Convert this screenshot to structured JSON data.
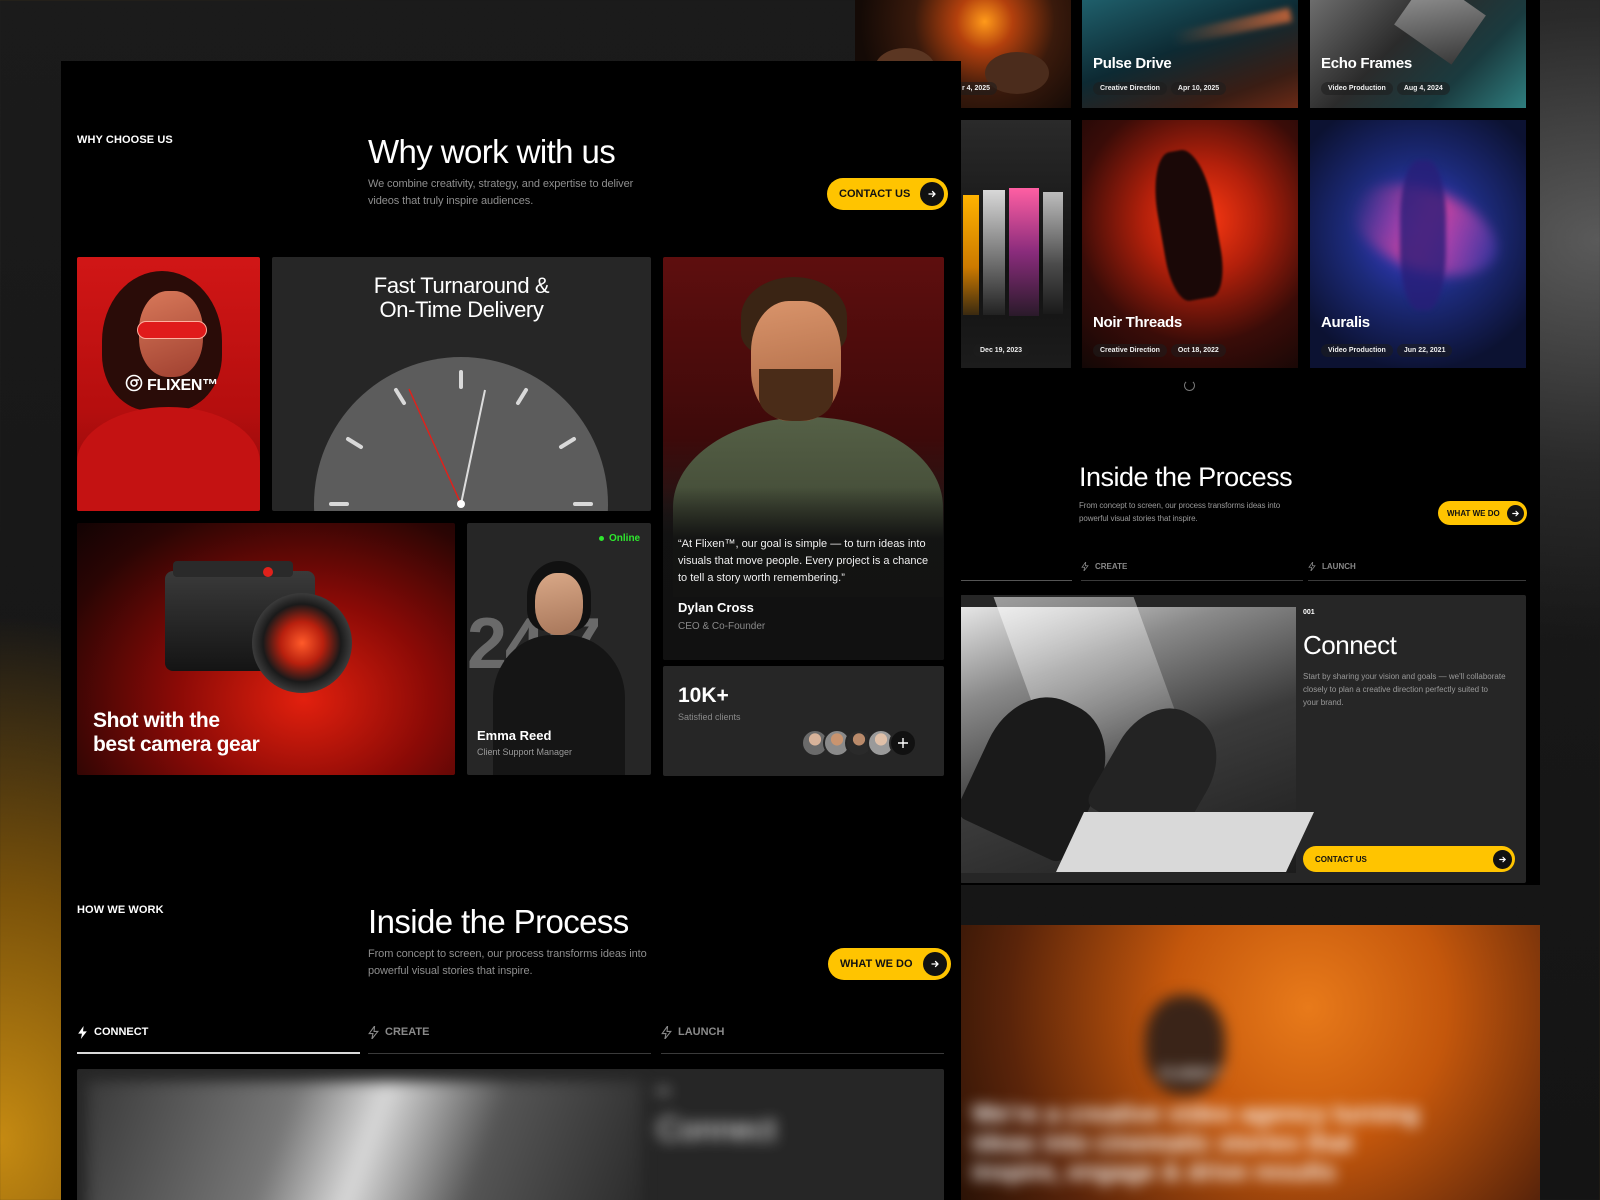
{
  "why": {
    "eyebrow": "WHY CHOOSE US",
    "title": "Why work with us",
    "subtitle_line1": "We combine creativity, strategy, and expertise to deliver",
    "subtitle_line2": "videos that truly inspire audiences.",
    "cta": "CONTACT US"
  },
  "brand": {
    "logo": "FLIXEN™"
  },
  "delivery": {
    "title_line1": "Fast Turnaround &",
    "title_line2": "On-Time Delivery"
  },
  "testimonial": {
    "quote_line1": "“At Flixen™, our goal is simple — to turn ideas into",
    "quote_line2": "visuals that move people. Every project is a chance",
    "quote_line3": "to tell a story worth remembering.”",
    "name": "Dylan Cross",
    "role": "CEO & Co-Founder"
  },
  "gear": {
    "line1": "Shot with the",
    "line2": "best camera gear"
  },
  "support": {
    "status": "Online",
    "big_text": "24/7",
    "name": "Emma Reed",
    "role": "Client Support Manager"
  },
  "clients": {
    "count": "10K+",
    "label": "Satisfied clients"
  },
  "process": {
    "eyebrow": "HOW WE WORK",
    "title": "Inside the Process",
    "subtitle_line1": "From concept to screen, our process transforms ideas into",
    "subtitle_line2": "powerful visual stories that inspire.",
    "cta": "WHAT WE DO",
    "tabs": [
      {
        "label": "CONNECT",
        "active": true
      },
      {
        "label": "CREATE",
        "active": false
      },
      {
        "label": "LAUNCH",
        "active": false
      }
    ],
    "blurred_step_num": "001",
    "blurred_step_title": "Connect"
  },
  "projects": [
    {
      "title": "",
      "tag": "",
      "date": "r 4, 2025"
    },
    {
      "title": "Pulse Drive",
      "tag": "Creative Direction",
      "date": "Apr 10, 2025"
    },
    {
      "title": "Echo Frames",
      "tag": "Video Production",
      "date": "Aug 4, 2024"
    },
    {
      "title": "",
      "tag": "",
      "date": "Dec 19, 2023"
    },
    {
      "title": "Noir Threads",
      "tag": "Creative Direction",
      "date": "Oct 18, 2022"
    },
    {
      "title": "Auralis",
      "tag": "Video Production",
      "date": "Jun 22, 2021"
    }
  ],
  "process_right": {
    "title": "Inside the Process",
    "subtitle_line1": "From concept to screen, our process transforms ideas into",
    "subtitle_line2": "powerful visual stories that inspire.",
    "cta": "WHAT WE DO",
    "tabs": [
      "CREATE",
      "LAUNCH"
    ],
    "step_num": "001",
    "step_title": "Connect",
    "step_desc_line1": "Start by sharing your vision and goals — we'll collaborate",
    "step_desc_line2": "closely to plan a creative direction perfectly suited to",
    "step_desc_line3": "your brand.",
    "step_cta": "CONTACT US"
  },
  "hero_blur": {
    "logo": "FLIXEN™",
    "line1": "We're a creative video agency turning",
    "line2": "ideas into cinematic stories that",
    "line3": "inspire, engage & drive results"
  },
  "colors": {
    "accent": "#ffc400",
    "online": "#2ee62e",
    "panel": "#000000",
    "card": "#262626"
  }
}
